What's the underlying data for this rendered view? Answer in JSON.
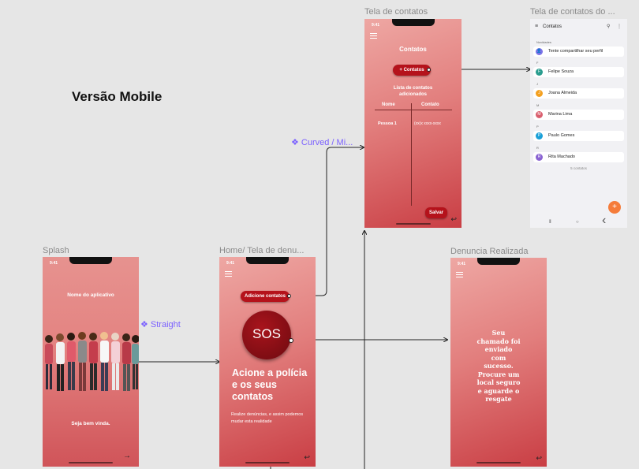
{
  "heading": "Versão Mobile",
  "frames": {
    "splash": {
      "label": "Splash",
      "time": "9:41",
      "app_name": "Nome do aplicativo",
      "welcome": "Seja bem vinda."
    },
    "home": {
      "label": "Home/ Tela de denu...",
      "time": "9:41",
      "add_contacts": "Adicione contatos",
      "sos": "SOS",
      "headline": "Acione a polícia e os seus contatos",
      "body": "Realize denúncias, e assim podemos mudar esta realidade"
    },
    "contatos": {
      "label": "Tela de contatos",
      "time": "9:41",
      "title": "Contatos",
      "add_button": "+ Contatos",
      "list_title": "Lista de contatos adicionados",
      "col_name": "Nome",
      "col_contact": "Contato",
      "row_name": "Pessoa 1",
      "row_contact": "(xx)x xxxx-xxxx",
      "save": "Salvar"
    },
    "contatos_do": {
      "label": "Tela de contatos do ...",
      "app_title": "Contatos",
      "section_new": "Novidades",
      "share_text": "Tente compartilhar seu perfil",
      "contacts": [
        {
          "letter": "F",
          "name": "Felipe Souza",
          "initial": "F",
          "color": "#2a9d8f"
        },
        {
          "letter": "J",
          "name": "Joana Almeida",
          "initial": "J",
          "color": "#f4a020"
        },
        {
          "letter": "M",
          "name": "Marina Lima",
          "initial": "M",
          "color": "#d95f6e"
        },
        {
          "letter": "P",
          "name": "Paulo Gomes",
          "initial": "P",
          "color": "#1aa0d8"
        },
        {
          "letter": "R",
          "name": "Rita Machado",
          "initial": "R",
          "color": "#8a63d2"
        }
      ],
      "count": "5 contatos",
      "fab": "+"
    },
    "denuncia": {
      "label": "Denuncia Realizada",
      "time": "9:41",
      "message": "Seu chamado foi enviado com sucesso. Procure um local seguro e aguarde o resgate"
    }
  },
  "connectors": {
    "straight": "❖ Straight",
    "curved": "❖ Curved / Mi..."
  },
  "colors": {
    "accent": "#b5121b",
    "connector_label": "#7b61ff"
  }
}
